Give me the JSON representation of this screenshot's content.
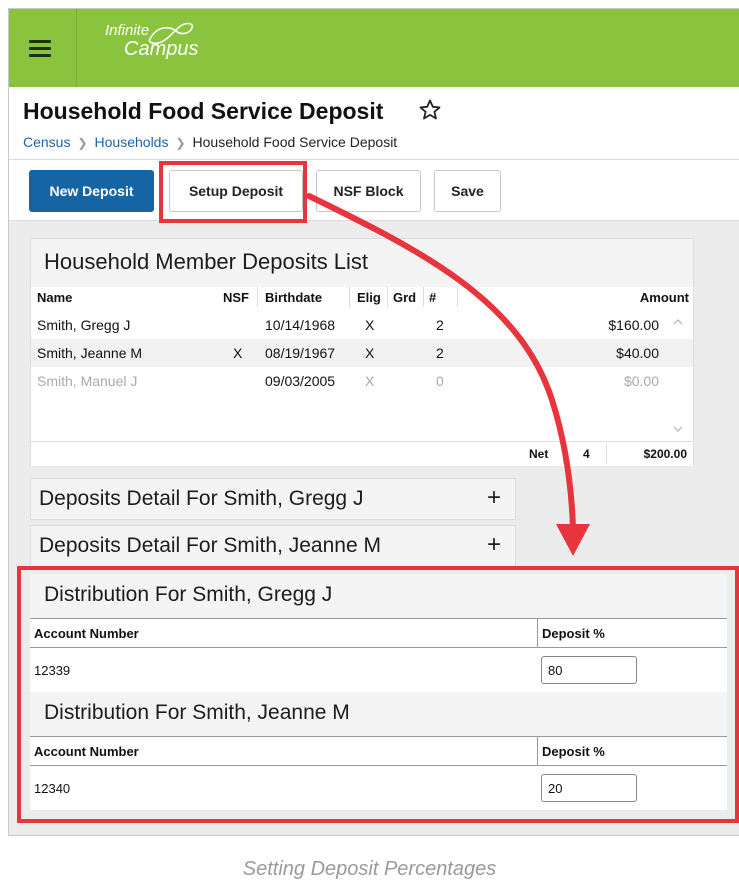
{
  "app": {
    "brand_line1": "Infinite",
    "brand_line2": "Campus",
    "accent": "#8ac43f",
    "highlight": "#e8343c"
  },
  "header": {
    "title": "Household Food Service Deposit",
    "breadcrumb": [
      "Census",
      "Households",
      "Household Food Service Deposit"
    ]
  },
  "toolbar": {
    "new_deposit": "New Deposit",
    "setup_deposit": "Setup Deposit",
    "nsf_block": "NSF Block",
    "save": "Save"
  },
  "members_list": {
    "title": "Household Member Deposits List",
    "columns": [
      "Name",
      "NSF",
      "Birthdate",
      "Elig",
      "Grd",
      "#",
      "Amount"
    ],
    "rows": [
      {
        "name": "Smith, Gregg J",
        "nsf": "",
        "birthdate": "10/14/1968",
        "elig": "X",
        "grd": "",
        "count": "2",
        "amount": "$160.00"
      },
      {
        "name": "Smith, Jeanne M",
        "nsf": "X",
        "birthdate": "08/19/1967",
        "elig": "X",
        "grd": "",
        "count": "2",
        "amount": "$40.00"
      },
      {
        "name": "Smith, Manuel J",
        "nsf": "",
        "birthdate": "09/03/2005",
        "elig": "X",
        "grd": "",
        "count": "0",
        "amount": "$0.00"
      }
    ],
    "footer": {
      "label": "Net",
      "count": "4",
      "amount": "$200.00"
    }
  },
  "details": [
    {
      "title": "Deposits Detail For Smith, Gregg J"
    },
    {
      "title": "Deposits Detail For Smith, Jeanne M"
    }
  ],
  "distributions": [
    {
      "title": "Distribution For Smith, Gregg J",
      "col_account": "Account Number",
      "col_pct": "Deposit %",
      "account": "12339",
      "pct": "80"
    },
    {
      "title": "Distribution For Smith, Jeanne M",
      "col_account": "Account Number",
      "col_pct": "Deposit %",
      "account": "12340",
      "pct": "20"
    }
  ],
  "caption": "Setting Deposit Percentages"
}
